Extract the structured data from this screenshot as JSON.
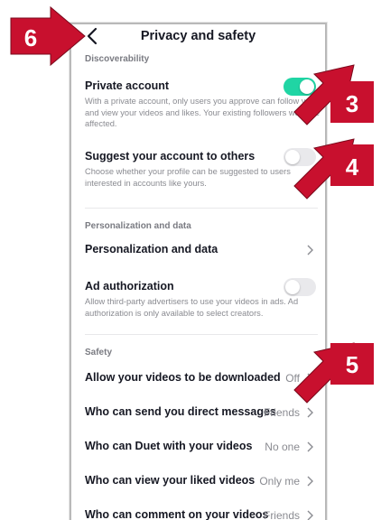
{
  "header": {
    "title": "Privacy and safety"
  },
  "sections": {
    "discoverability": "Discoverability",
    "personalization": "Personalization and data",
    "safety": "Safety"
  },
  "private_account": {
    "title": "Private account",
    "description": "With a private account, only users you approve can follow you and view your videos and likes. Your existing followers won't be affected.",
    "enabled": true
  },
  "suggest_account": {
    "title": "Suggest your account to others",
    "description": "Choose whether your profile can be suggested to users interested in accounts like yours.",
    "enabled": false
  },
  "personalization_row": {
    "title": "Personalization and data"
  },
  "ad_authorization": {
    "title": "Ad authorization",
    "description": "Allow third-party advertisers to use your videos in ads. Ad authorization is only available to select creators.",
    "enabled": false
  },
  "safety_rows": [
    {
      "title": "Allow your videos to be downloaded",
      "value": "Off"
    },
    {
      "title": "Who can send you direct messages",
      "value": "Friends"
    },
    {
      "title": "Who can Duet with your videos",
      "value": "No one"
    },
    {
      "title": "Who can view your liked videos",
      "value": "Only me"
    },
    {
      "title": "Who can comment on your videos",
      "value": "Friends"
    }
  ],
  "callouts": [
    "6",
    "3",
    "4",
    "5"
  ],
  "colors": {
    "toggle_on": "#20d5a4",
    "toggle_off": "#e9e9ec",
    "callout": "#c8102e"
  },
  "icons": {
    "back": "chevron-left-icon",
    "row": "chevron-right-icon"
  }
}
